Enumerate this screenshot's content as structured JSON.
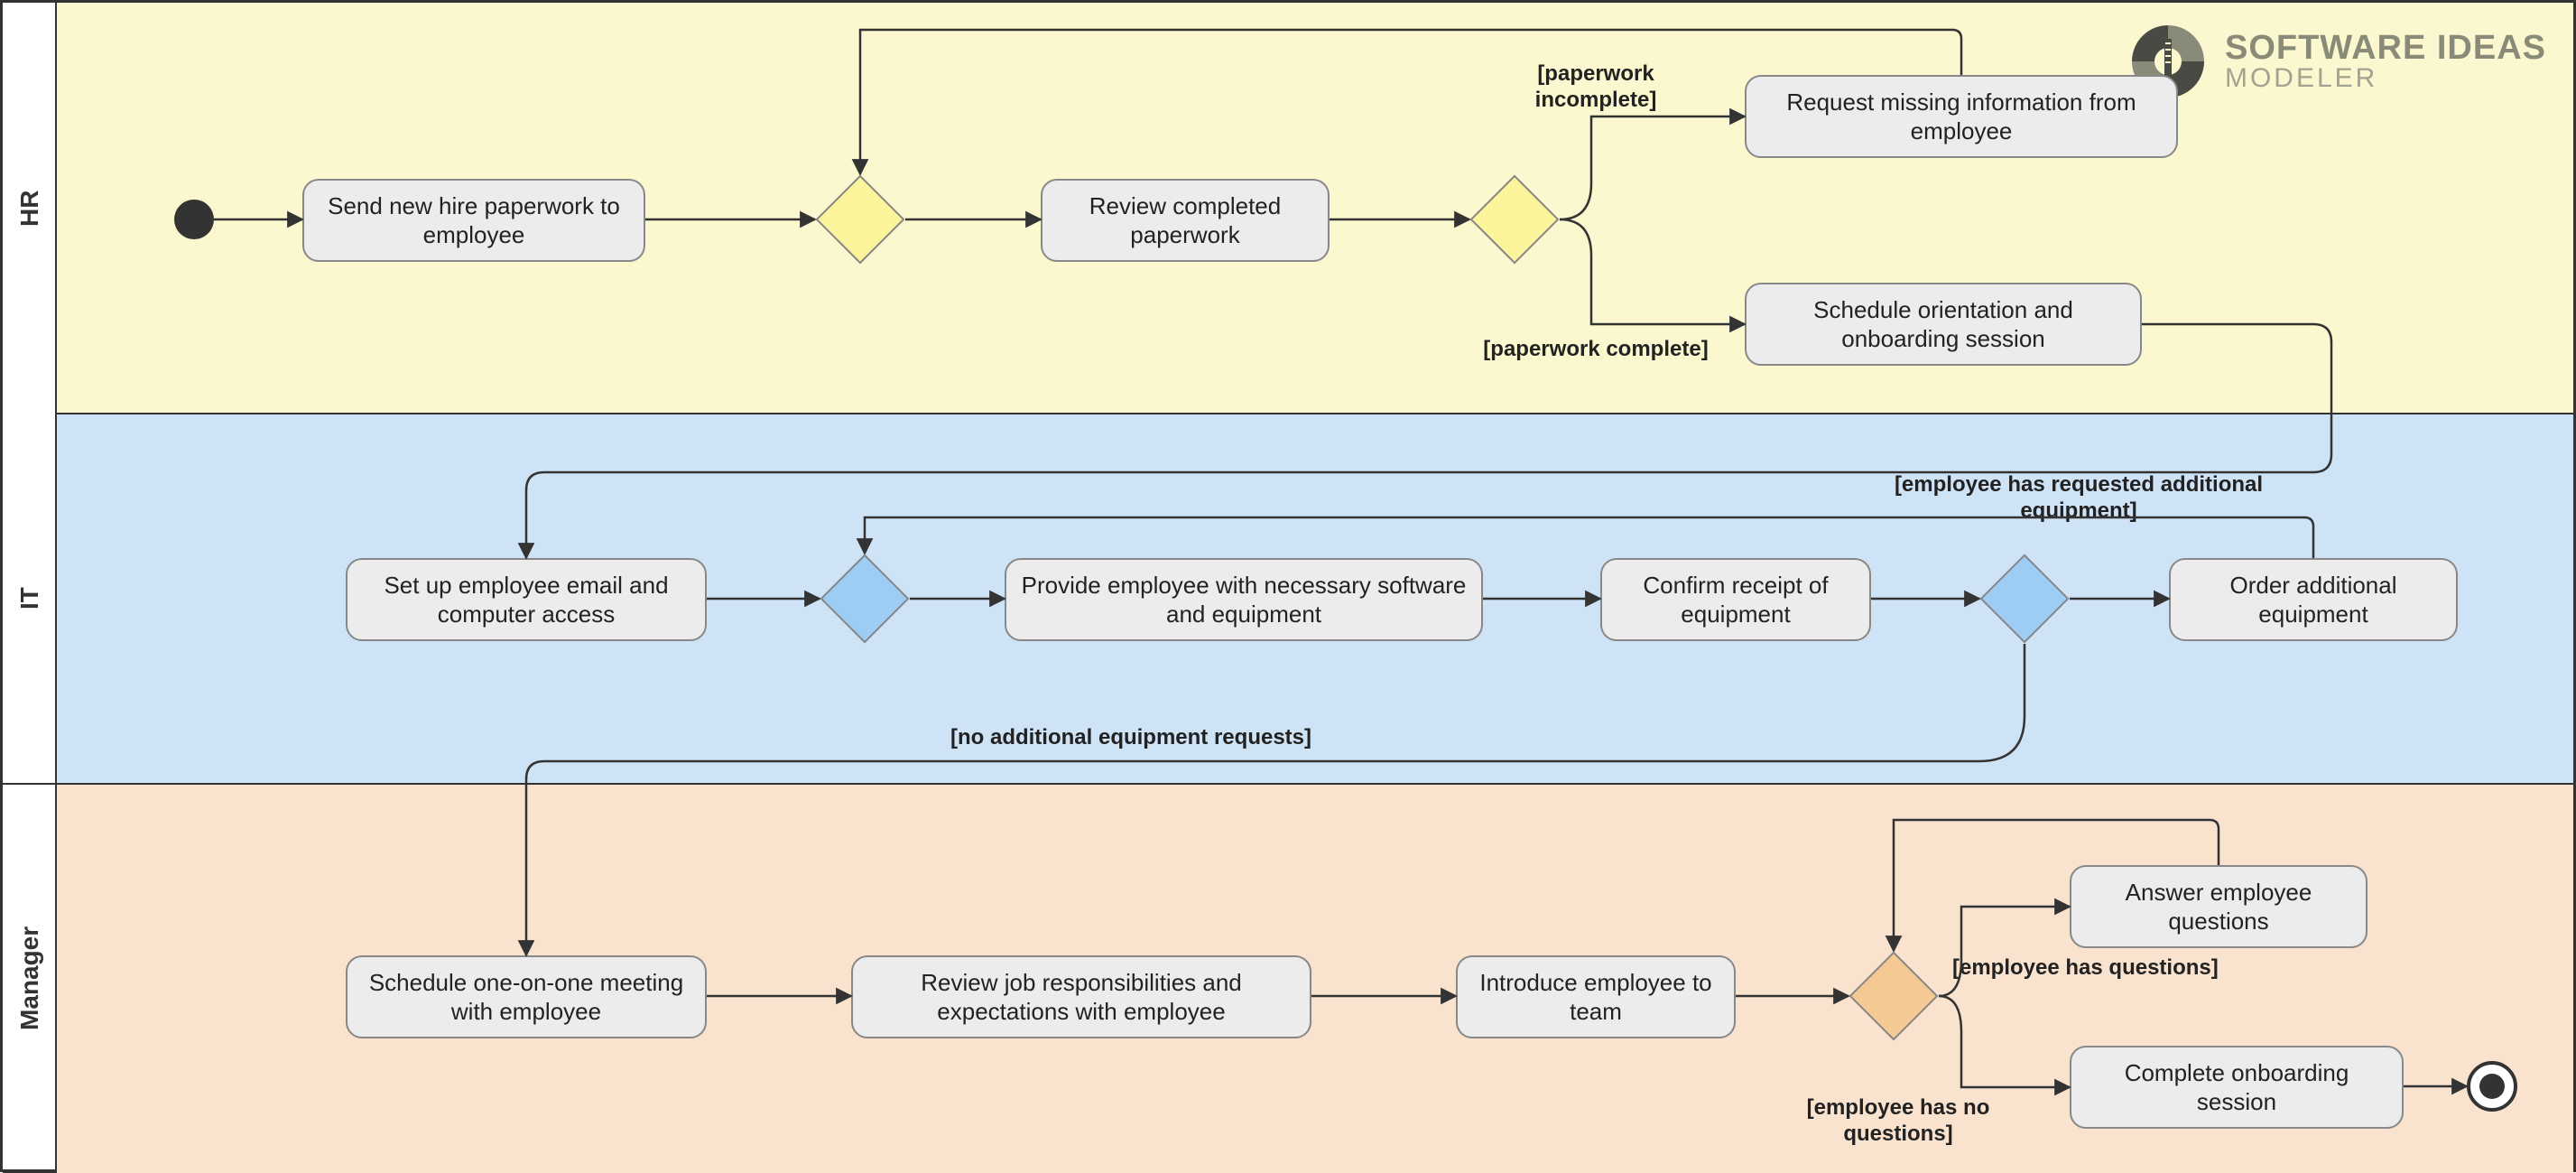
{
  "lanes": {
    "hr": "HR",
    "it": "IT",
    "mgr": "Manager"
  },
  "logo": {
    "line1": "SOFTWARE IDEAS",
    "line2": "MODELER"
  },
  "hr": {
    "a1": "Send new hire paperwork to employee",
    "a2": "Review completed paperwork",
    "a3": "Request missing information from employee",
    "a4": "Schedule orientation and onboarding session",
    "g_incomplete": "[paperwork incomplete]",
    "g_complete": "[paperwork complete]"
  },
  "it": {
    "a1": "Set up employee email and computer access",
    "a2": "Provide employee with necessary software and equipment",
    "a3": "Confirm receipt of equipment",
    "a4": "Order additional equipment",
    "g_has": "[employee has requested additional equipment]",
    "g_no": "[no additional equipment requests]"
  },
  "mgr": {
    "a1": "Schedule one-on-one meeting with employee",
    "a2": "Review job responsibilities and expectations with employee",
    "a3": "Introduce employee to team",
    "a4": "Answer employee questions",
    "a5": "Complete onboarding session",
    "g_has": "[employee has questions]",
    "g_no": "[employee has no questions]"
  },
  "chart_data": {
    "type": "activity-diagram-swimlane",
    "lanes": [
      "HR",
      "IT",
      "Manager"
    ],
    "start": {
      "lane": "HR"
    },
    "end": {
      "lane": "Manager",
      "after": "Complete onboarding session"
    },
    "nodes": [
      {
        "id": "hr1",
        "lane": "HR",
        "label": "Send new hire paperwork to employee",
        "type": "activity"
      },
      {
        "id": "hrm1",
        "lane": "HR",
        "type": "merge"
      },
      {
        "id": "hr2",
        "lane": "HR",
        "label": "Review completed paperwork",
        "type": "activity"
      },
      {
        "id": "hrd1",
        "lane": "HR",
        "type": "decision"
      },
      {
        "id": "hr3",
        "lane": "HR",
        "label": "Request missing information from employee",
        "type": "activity"
      },
      {
        "id": "hr4",
        "lane": "HR",
        "label": "Schedule orientation and onboarding session",
        "type": "activity"
      },
      {
        "id": "it1",
        "lane": "IT",
        "label": "Set up employee email and computer access",
        "type": "activity"
      },
      {
        "id": "itm1",
        "lane": "IT",
        "type": "merge"
      },
      {
        "id": "it2",
        "lane": "IT",
        "label": "Provide employee with necessary software and equipment",
        "type": "activity"
      },
      {
        "id": "it3",
        "lane": "IT",
        "label": "Confirm receipt of equipment",
        "type": "activity"
      },
      {
        "id": "itd1",
        "lane": "IT",
        "type": "decision"
      },
      {
        "id": "it4",
        "lane": "IT",
        "label": "Order additional equipment",
        "type": "activity"
      },
      {
        "id": "mg1",
        "lane": "Manager",
        "label": "Schedule one-on-one meeting with employee",
        "type": "activity"
      },
      {
        "id": "mg2",
        "lane": "Manager",
        "label": "Review job responsibilities and expectations with employee",
        "type": "activity"
      },
      {
        "id": "mg3",
        "lane": "Manager",
        "label": "Introduce employee to team",
        "type": "activity"
      },
      {
        "id": "mgm1",
        "lane": "Manager",
        "type": "merge"
      },
      {
        "id": "mgd1",
        "lane": "Manager",
        "type": "decision"
      },
      {
        "id": "mg4",
        "lane": "Manager",
        "label": "Answer employee questions",
        "type": "activity"
      },
      {
        "id": "mg5",
        "lane": "Manager",
        "label": "Complete onboarding session",
        "type": "activity"
      }
    ],
    "edges": [
      {
        "from": "start",
        "to": "hr1"
      },
      {
        "from": "hr1",
        "to": "hrm1"
      },
      {
        "from": "hrm1",
        "to": "hr2"
      },
      {
        "from": "hr2",
        "to": "hrd1"
      },
      {
        "from": "hrd1",
        "to": "hr3",
        "guard": "[paperwork incomplete]"
      },
      {
        "from": "hr3",
        "to": "hrm1"
      },
      {
        "from": "hrd1",
        "to": "hr4",
        "guard": "[paperwork complete]"
      },
      {
        "from": "hr4",
        "to": "it1"
      },
      {
        "from": "it1",
        "to": "itm1"
      },
      {
        "from": "itm1",
        "to": "it2"
      },
      {
        "from": "it2",
        "to": "it3"
      },
      {
        "from": "it3",
        "to": "itd1"
      },
      {
        "from": "itd1",
        "to": "it4",
        "guard": "[employee has requested additional equipment]"
      },
      {
        "from": "it4",
        "to": "itm1"
      },
      {
        "from": "itd1",
        "to": "mg1",
        "guard": "[no additional equipment requests]"
      },
      {
        "from": "mg1",
        "to": "mg2"
      },
      {
        "from": "mg2",
        "to": "mg3"
      },
      {
        "from": "mg3",
        "to": "mgd1"
      },
      {
        "from": "mgd1",
        "to": "mg4",
        "guard": "[employee has questions]"
      },
      {
        "from": "mg4",
        "to": "mgd1"
      },
      {
        "from": "mgd1",
        "to": "mg5",
        "guard": "[employee has no questions]"
      },
      {
        "from": "mg5",
        "to": "end"
      }
    ]
  }
}
